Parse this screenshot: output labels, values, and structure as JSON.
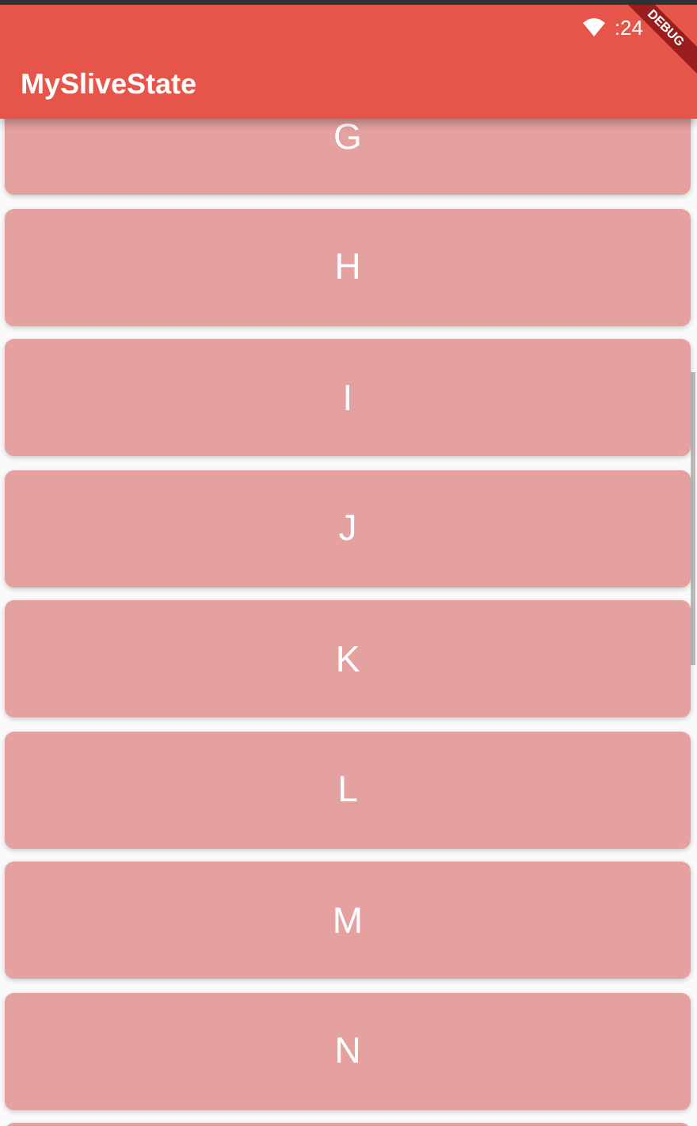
{
  "status_bar": {
    "time": ":24"
  },
  "app_bar": {
    "title": "MySliveState"
  },
  "debug_banner": "DEBUG",
  "cards": [
    {
      "label": "G"
    },
    {
      "label": "H"
    },
    {
      "label": "I"
    },
    {
      "label": "J"
    },
    {
      "label": "K"
    },
    {
      "label": "L"
    },
    {
      "label": "M"
    },
    {
      "label": "N"
    }
  ]
}
